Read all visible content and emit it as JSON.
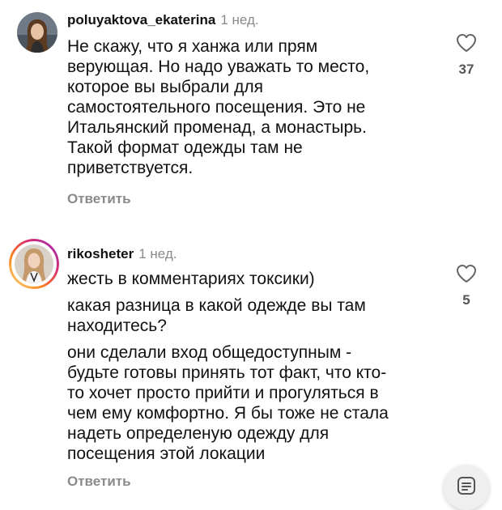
{
  "comments": [
    {
      "username": "poluyaktova_ekaterina",
      "time": "1 нед.",
      "lines": [
        "Не скажу, что я ханжа или прям",
        "верующая. Но надо уважать то место,",
        "которое вы выбрали для",
        "самостоятельного посещения. Это не",
        "Итальянский променад, а монастырь.",
        "Такой формат одежды там  не",
        "приветствуется."
      ],
      "reply_label": "Ответить",
      "likes": "37"
    },
    {
      "username": "rikosheter",
      "time": "1 нед.",
      "paragraphs": [
        [
          "жесть в комментариях токсики)"
        ],
        [
          "какая разница в какой одежде вы там",
          "находитесь?"
        ],
        [
          "они сделали вход общедоступным -",
          "будьте готовы принять тот факт, что кто-",
          "то хочет просто прийти и прогуляться в",
          "чем ему комфортно. Я бы тоже не стала",
          "надеть определеную одежду для",
          "посещения этой локации"
        ]
      ],
      "reply_label": "Ответить",
      "likes": "5",
      "story_ring_colors": [
        "#feda75",
        "#fa7e1e",
        "#d62976",
        "#962fbf"
      ]
    }
  ],
  "icons": {
    "like": "heart-outline-icon",
    "fab": "filter-lines-icon"
  },
  "colors": {
    "text": "#111111",
    "muted": "#8a8a8a"
  }
}
